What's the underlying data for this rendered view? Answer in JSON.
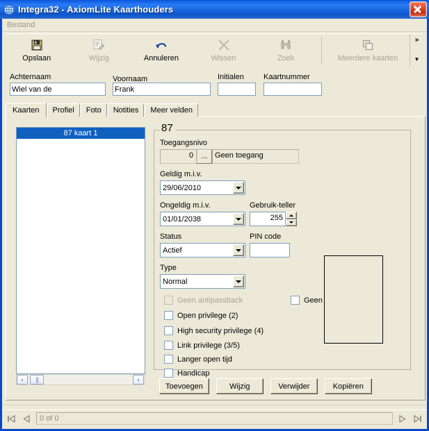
{
  "window": {
    "title": "Integra32 - AxiomLite Kaarthouders",
    "icon": "globe-icon",
    "close_label": "×",
    "accent": "#0a46c8",
    "face": "#ece9d8"
  },
  "menubar": {
    "items": [
      {
        "label": "Bestand"
      }
    ]
  },
  "toolbar": {
    "buttons": [
      {
        "label": "Opslaan",
        "icon": "save-icon",
        "enabled": true
      },
      {
        "label": "Wijzig",
        "icon": "edit-icon",
        "enabled": false
      },
      {
        "label": "Annuleren",
        "icon": "undo-icon",
        "enabled": true
      },
      {
        "label": "Wissen",
        "icon": "delete-x-icon",
        "enabled": false
      },
      {
        "label": "Zoek",
        "icon": "binoculars-icon",
        "enabled": false
      },
      {
        "label": "Meerdere kaarten",
        "icon": "copy-cards-icon",
        "enabled": false
      }
    ],
    "overflow_chevron": "»",
    "overflow_down": "▼"
  },
  "person_form": {
    "lastname": {
      "label": "Achternaam",
      "value": "Wiel van de",
      "placeholder": ""
    },
    "firstname": {
      "label": "Voornaam",
      "value": "Frank",
      "placeholder": ""
    },
    "initials": {
      "label": "Initialen",
      "value": "",
      "placeholder": ""
    },
    "cardnumber": {
      "label": "Kaartnummer",
      "value": "",
      "placeholder": ""
    }
  },
  "tabs": [
    {
      "label": "Kaarten",
      "active": true
    },
    {
      "label": "Profiel",
      "active": false
    },
    {
      "label": "Foto",
      "active": false
    },
    {
      "label": "Notities",
      "active": false
    },
    {
      "label": "Meer velden",
      "active": false
    }
  ],
  "card_list": {
    "items": [
      {
        "label": "87  kaart 1",
        "selected": true
      }
    ],
    "scroll_left": "‹",
    "scroll_right": "›",
    "scroll_thumb": "|||"
  },
  "card_detail": {
    "group_title": "87",
    "access_level": {
      "label": "Toegangsnivo",
      "number": "0",
      "browse_label": "...",
      "name": "Geen toegang"
    },
    "valid_from": {
      "label": "Geldig m.i.v.",
      "value": "29/06/2010"
    },
    "invalid_from": {
      "label": "Ongeldig m.i.v.",
      "value": "01/01/2038"
    },
    "use_counter": {
      "label": "Gebruik-teller",
      "value": "255"
    },
    "status": {
      "label": "Status",
      "value": "Actief"
    },
    "pin_code": {
      "label": "PIN code",
      "value": "",
      "placeholder": ""
    },
    "type": {
      "label": "Type",
      "value": "Normal"
    },
    "checkboxes_left": [
      {
        "label": "Geen antipassback",
        "checked": false,
        "enabled": false
      },
      {
        "label": "Open privilege (2)",
        "checked": false,
        "enabled": true
      },
      {
        "label": "High security privilege (4)",
        "checked": false,
        "enabled": true
      },
      {
        "label": "Link privilege (3/5)",
        "checked": false,
        "enabled": true
      },
      {
        "label": "Langer open tijd",
        "checked": false,
        "enabled": true
      },
      {
        "label": "Handicap",
        "checked": false,
        "enabled": true
      }
    ],
    "checkboxes_right": [
      {
        "label": "Geen auto deactiveren",
        "checked": false,
        "enabled": true
      }
    ],
    "photo_placeholder": "photo-frame"
  },
  "card_actions": [
    {
      "label": "Toevoegen"
    },
    {
      "label": "Wijzig"
    },
    {
      "label": "Verwijder"
    },
    {
      "label": "Kopiëren"
    }
  ],
  "record_nav": {
    "first_icon": "nav-first-icon",
    "prev_icon": "nav-prev-icon",
    "next_icon": "nav-next-icon",
    "last_icon": "nav-last-icon",
    "status_text": "0 of 0"
  }
}
